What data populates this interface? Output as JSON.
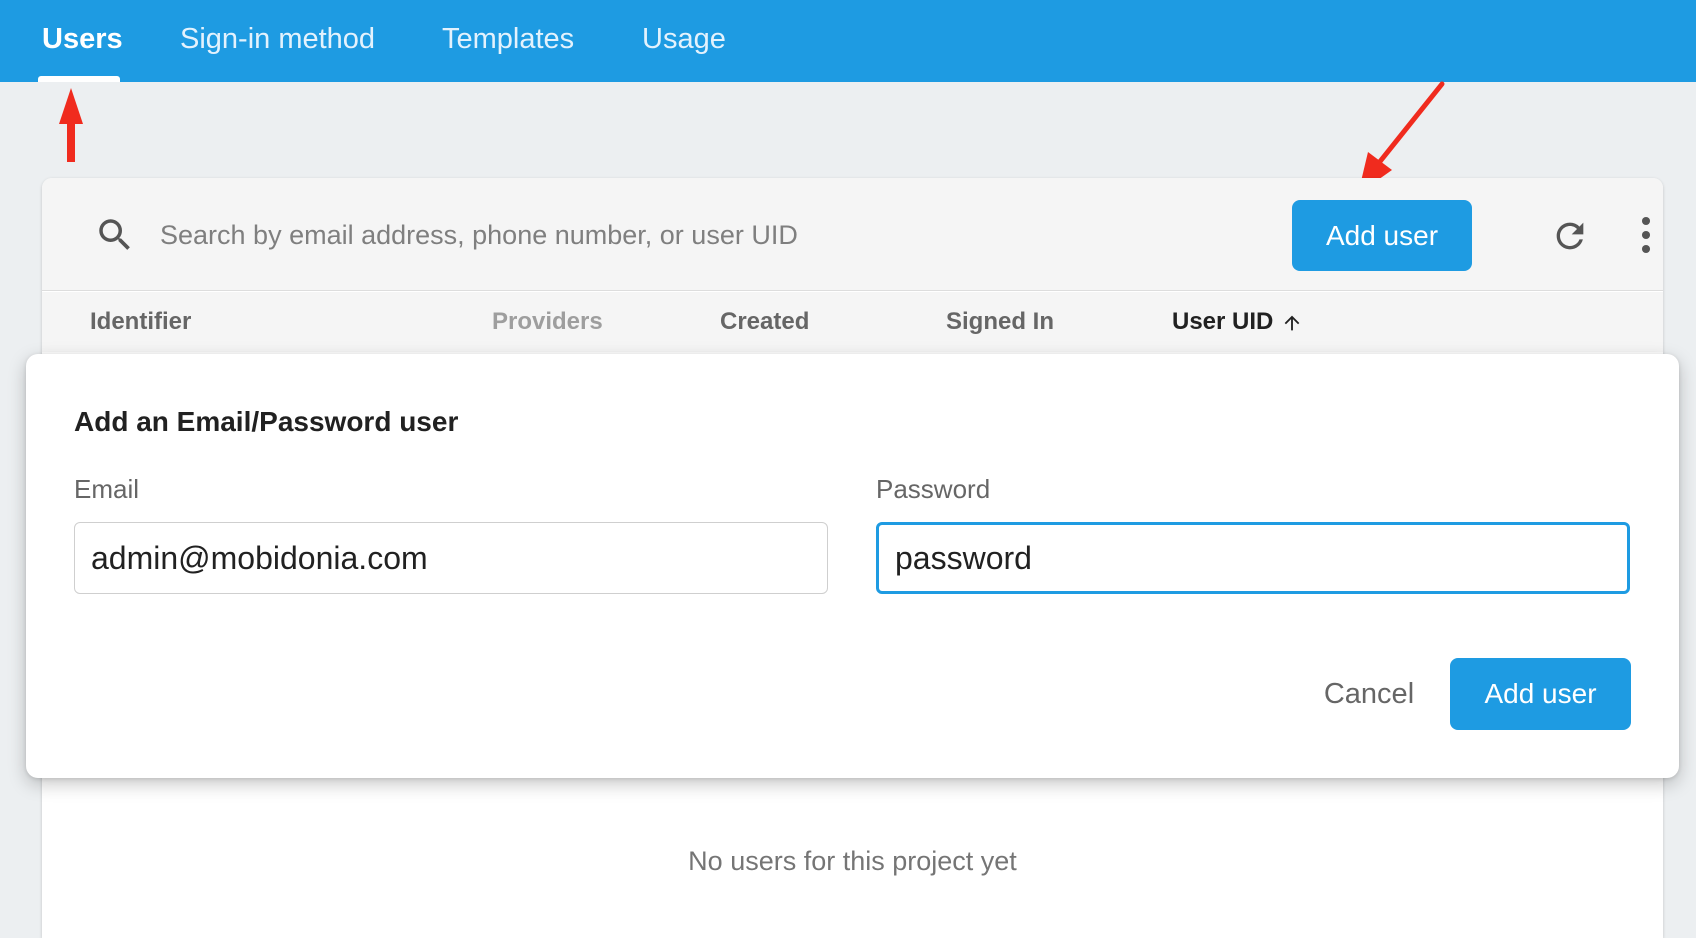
{
  "tabs": [
    {
      "label": "Users",
      "active": true
    },
    {
      "label": "Sign-in method",
      "active": false
    },
    {
      "label": "Templates",
      "active": false
    },
    {
      "label": "Usage",
      "active": false
    }
  ],
  "toolbar": {
    "search_placeholder": "Search by email address, phone number, or user UID",
    "add_user_label": "Add user"
  },
  "table": {
    "columns": [
      "Identifier",
      "Providers",
      "Created",
      "Signed In",
      "User UID"
    ],
    "sorted_column": "User UID",
    "empty_message": "No users for this project yet"
  },
  "dialog": {
    "title": "Add an Email/Password user",
    "email_label": "Email",
    "email_value": "admin@mobidonia.com",
    "password_label": "Password",
    "password_value": "password",
    "cancel_label": "Cancel",
    "submit_label": "Add user"
  },
  "colors": {
    "brand": "#1e9be2",
    "annotation_arrow": "#f02b1e"
  },
  "icons": [
    "search-icon",
    "refresh-icon",
    "more-vert-icon",
    "arrow-up-icon"
  ]
}
